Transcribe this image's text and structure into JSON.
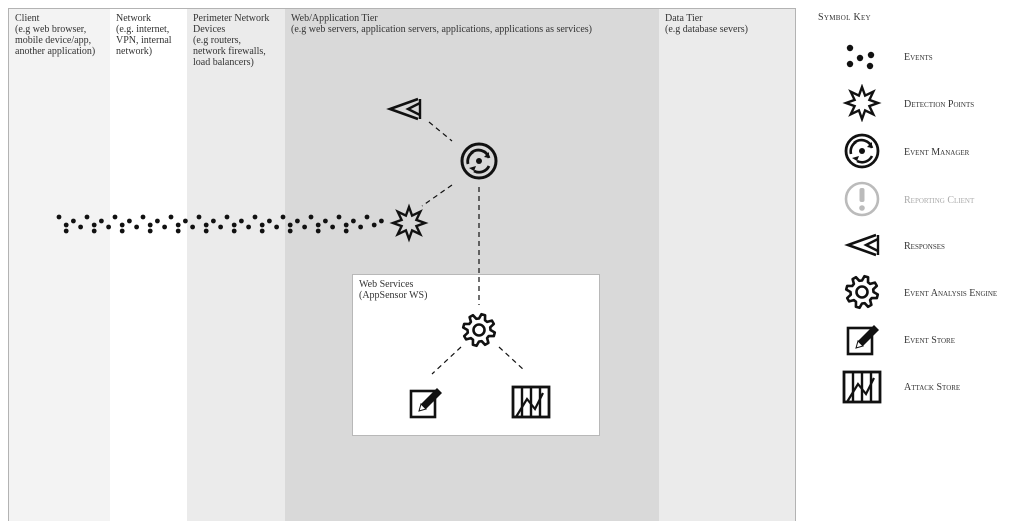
{
  "tiers": [
    {
      "title": "Client",
      "desc": [
        "(e.g web browser,",
        "mobile device/app,",
        "another application)"
      ],
      "color": "#f3f3f3"
    },
    {
      "title": "Network",
      "desc": [
        "(e.g. internet,",
        "VPN, internal",
        "network)"
      ],
      "color": "#ffffff"
    },
    {
      "title": "Perimeter Network",
      "desc": [
        "Devices",
        "(e.g routers,",
        "network firewalls,",
        "load balancers)"
      ],
      "color": "#ebebeb"
    },
    {
      "title": "Web/Application Tier",
      "desc": [
        "(e.g web servers, application servers, applications, applications as services)"
      ],
      "color": "#d9d9d9"
    },
    {
      "title": "Data Tier",
      "desc": [
        "(e.g database severs)"
      ],
      "color": "#ebebeb"
    }
  ],
  "web_services": {
    "title": "Web Services",
    "subtitle": "(AppSensor WS)"
  },
  "symbol_key": {
    "title": "Symbol Key",
    "items": [
      {
        "label": "Events",
        "icon": "events-icon",
        "faded": false
      },
      {
        "label": "Detection Points",
        "icon": "detection-point-icon",
        "faded": false
      },
      {
        "label": "Event Manager",
        "icon": "event-manager-icon",
        "faded": false
      },
      {
        "label": "Reporting Client",
        "icon": "reporting-client-icon",
        "faded": true
      },
      {
        "label": "Responses",
        "icon": "responses-icon",
        "faded": false
      },
      {
        "label": "Event Analysis Engine",
        "icon": "event-analysis-engine-icon",
        "faded": false
      },
      {
        "label": "Event Store",
        "icon": "event-store-icon",
        "faded": false
      },
      {
        "label": "Attack Store",
        "icon": "attack-store-icon",
        "faded": false
      }
    ]
  },
  "colors": {
    "line": "#111111",
    "faded": "#bbbbbb",
    "border": "#b3b3b3"
  }
}
